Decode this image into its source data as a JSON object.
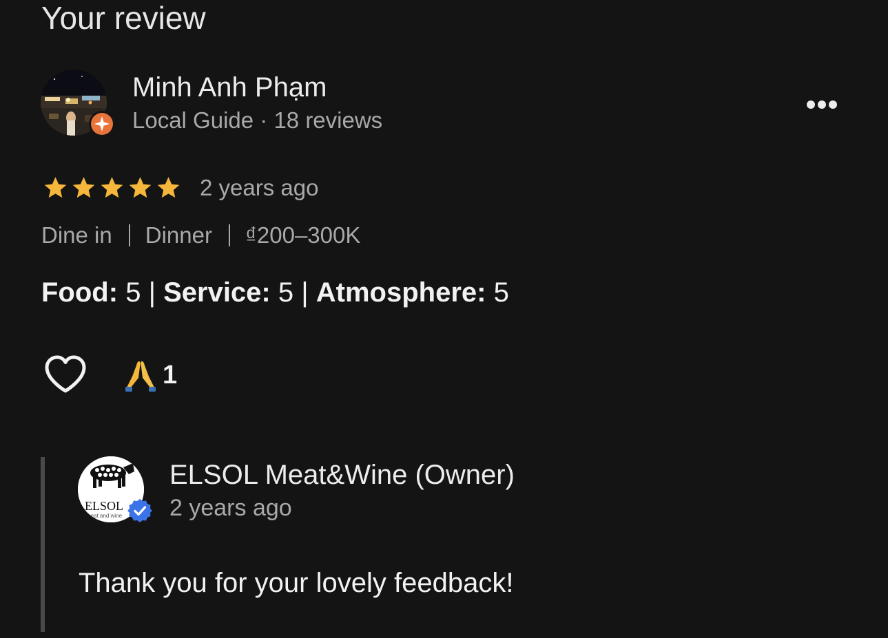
{
  "section": {
    "title": "Your review"
  },
  "reviewer": {
    "name": "Minh Anh Phạm",
    "meta": "Local Guide · 18 reviews",
    "avatar_icon": "user-photo-avatar",
    "badge_icon": "local-guide-star-badge",
    "badge_color": "#e8743b"
  },
  "menu": {
    "icon": "more-dots-icon"
  },
  "review": {
    "star_count": 5,
    "star_color": "#f5b63b",
    "time": "2 years ago",
    "tags": [
      "Dine in",
      "Dinner",
      "₫200–300K"
    ],
    "ratings": [
      {
        "label": "Food:",
        "value": "5"
      },
      {
        "label": "Service:",
        "value": "5"
      },
      {
        "label": "Atmosphere:",
        "value": "5"
      }
    ]
  },
  "actions": {
    "like_icon": "heart-outline-icon",
    "reaction_emoji": "🙏",
    "reaction_count": "1"
  },
  "owner_reply": {
    "name": "ELSOL Meat&Wine (Owner)",
    "time": "2 years ago",
    "text": "Thank you for your lovely feedback!",
    "logo_text": "ELSOL",
    "logo_subtext": "meat and wine",
    "verified_color": "#3b74e8"
  }
}
